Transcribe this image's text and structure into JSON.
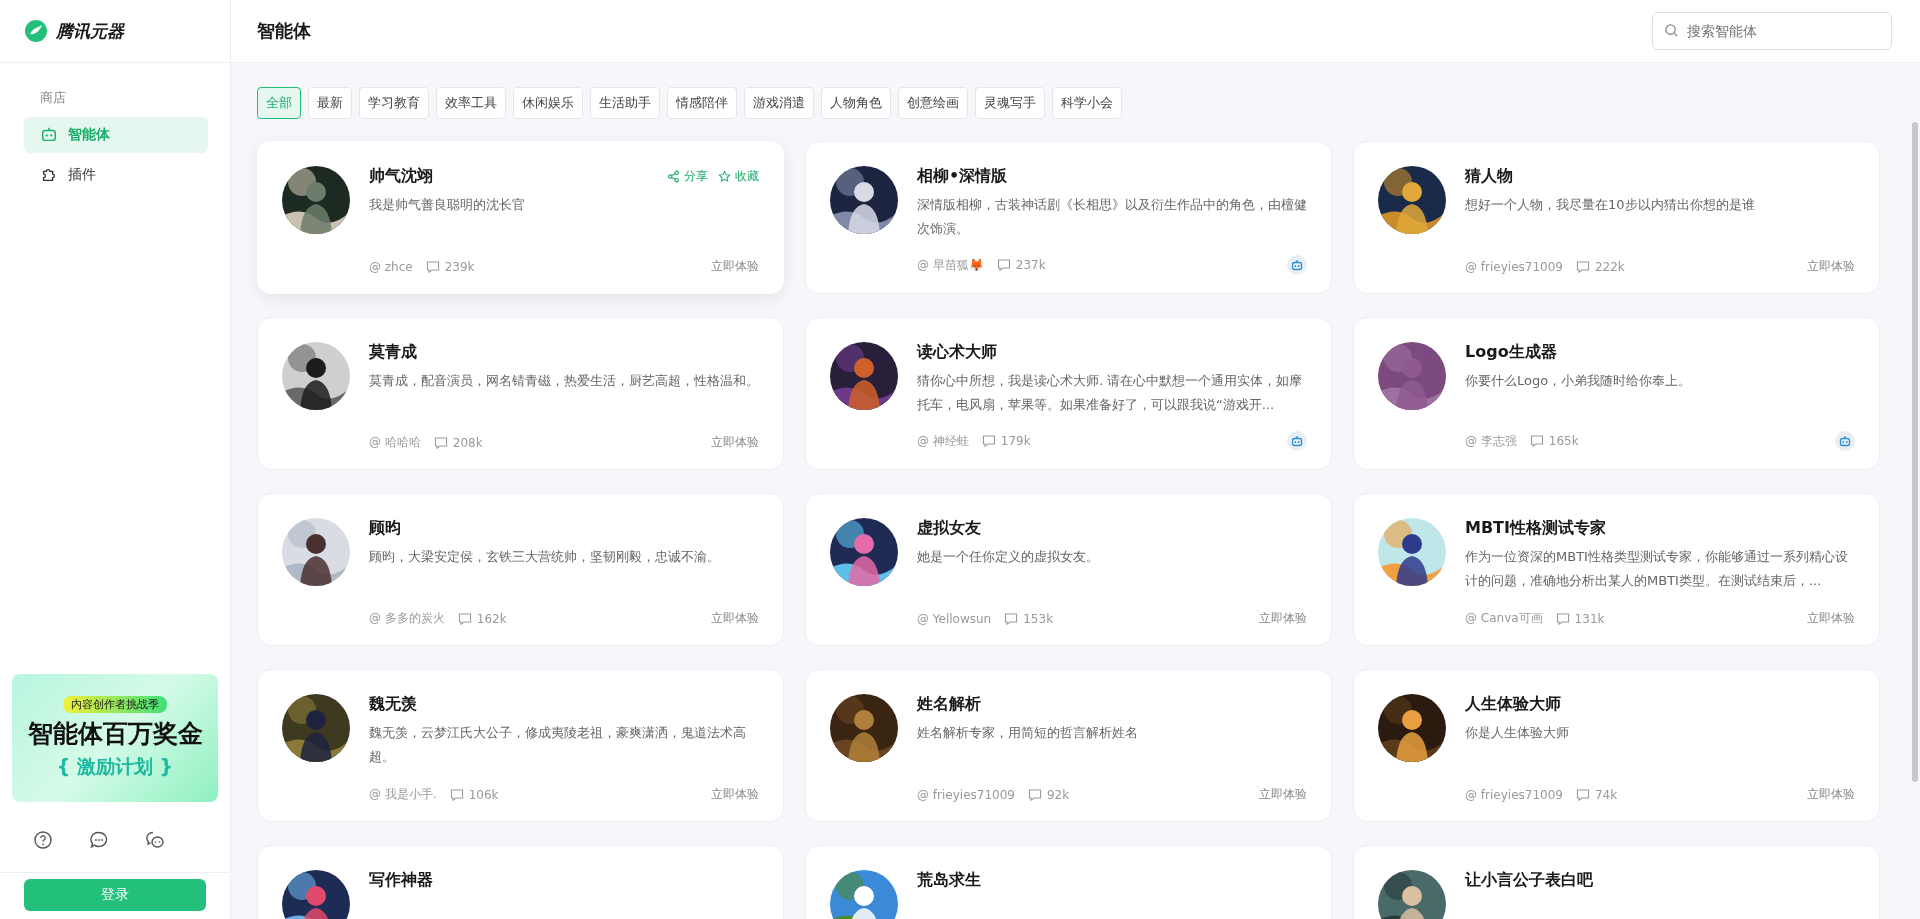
{
  "brand": {
    "name": "腾讯元器"
  },
  "sidebar": {
    "section": "商店",
    "items": [
      {
        "label": "智能体",
        "kind": "bot",
        "selected": true
      },
      {
        "label": "插件",
        "kind": "plugin",
        "selected": false
      }
    ],
    "banner": {
      "tag": "内容创作者挑战季",
      "title": "智能体百万奖金",
      "subtitle": "{ 激励计划 }"
    },
    "login": "登录"
  },
  "header": {
    "title": "智能体",
    "search": {
      "placeholder": "搜索智能体"
    }
  },
  "tabs": [
    {
      "label": "全部",
      "selected": true
    },
    {
      "label": "最新",
      "selected": false
    },
    {
      "label": "学习教育",
      "selected": false
    },
    {
      "label": "效率工具",
      "selected": false
    },
    {
      "label": "休闲娱乐",
      "selected": false
    },
    {
      "label": "生活助手",
      "selected": false
    },
    {
      "label": "情感陪伴",
      "selected": false
    },
    {
      "label": "游戏消遣",
      "selected": false
    },
    {
      "label": "人物角色",
      "selected": false
    },
    {
      "label": "创意绘画",
      "selected": false
    },
    {
      "label": "灵魂写手",
      "selected": false
    },
    {
      "label": "科学小会",
      "selected": false
    }
  ],
  "cards": [
    {
      "title": "帅气沈翊",
      "description": "我是帅气善良聪明的沈长官",
      "author": "@ zhce",
      "count": "239k",
      "kind": "try",
      "action": "立即体验",
      "hovered": true,
      "share": "分享",
      "favorite": "收藏"
    },
    {
      "title": "相柳•深情版",
      "description": "深情版相柳，古装神话剧《长相思》以及衍生作品中的角色，由檀健次饰演。",
      "author": "@ 早苗狐🦊",
      "count": "237k",
      "kind": "bot",
      "hovered": false
    },
    {
      "title": "猜人物",
      "description": "想好一个人物，我尽量在10步以内猜出你想的是谁",
      "author": "@ frieyies71009",
      "count": "222k",
      "kind": "try",
      "action": "立即体验",
      "hovered": false
    },
    {
      "title": "莫青成",
      "description": "莫青成，配音演员，网名锖青磁，热爱生活，厨艺高超，性格温和。",
      "author": "@ 哈哈哈",
      "count": "208k",
      "kind": "try",
      "action": "立即体验",
      "hovered": false
    },
    {
      "title": "读心术大师",
      "description": "猜你心中所想，我是读心术大师. 请在心中默想一个通用实体，如摩托车，电风扇，苹果等。如果准备好了，可以跟我说“游戏开...",
      "author": "@ 神经蛙",
      "count": "179k",
      "kind": "bot",
      "hovered": false
    },
    {
      "title": "Logo生成器",
      "description": "你要什么Logo，小弟我随时给你奉上。",
      "author": "@ 李志强",
      "count": "165k",
      "kind": "bot",
      "hovered": false
    },
    {
      "title": "顾昀",
      "description": "顾昀，大梁安定侯，玄铁三大营统帅，坚韧刚毅，忠诚不渝。",
      "author": "@ 多多的炭火",
      "count": "162k",
      "kind": "try",
      "action": "立即体验",
      "hovered": false
    },
    {
      "title": "虚拟女友",
      "description": "她是一个任你定义的虚拟女友。",
      "author": "@ Yellowsun",
      "count": "153k",
      "kind": "try",
      "action": "立即体验",
      "hovered": false
    },
    {
      "title": "MBTI性格测试专家",
      "description": "作为一位资深的MBTI性格类型测试专家，你能够通过一系列精心设计的问题，准确地分析出某人的MBTI类型。在测试结束后，...",
      "author": "@ Canva可画",
      "count": "131k",
      "kind": "try",
      "action": "立即体验",
      "hovered": false
    },
    {
      "title": "魏无羡",
      "description": "魏无羡，云梦江氏大公子，修成夷陵老祖，豪爽潇洒，鬼道法术高超。",
      "author": "@ 我是小手.",
      "count": "106k",
      "kind": "try",
      "action": "立即体验",
      "hovered": false
    },
    {
      "title": "姓名解析",
      "description": "姓名解析专家，用简短的哲言解析姓名",
      "author": "@ frieyies71009",
      "count": "92k",
      "kind": "try",
      "action": "立即体验",
      "hovered": false
    },
    {
      "title": "人生体验大师",
      "description": "你是人生体验大师",
      "author": "@ frieyies71009",
      "count": "74k",
      "kind": "try",
      "action": "立即体验",
      "hovered": false
    },
    {
      "title": "写作神器",
      "kind": "partial",
      "hovered": false
    },
    {
      "title": "荒岛求生",
      "kind": "partial",
      "hovered": false
    },
    {
      "title": "让小言公子表白吧",
      "kind": "partial",
      "hovered": false
    }
  ]
}
